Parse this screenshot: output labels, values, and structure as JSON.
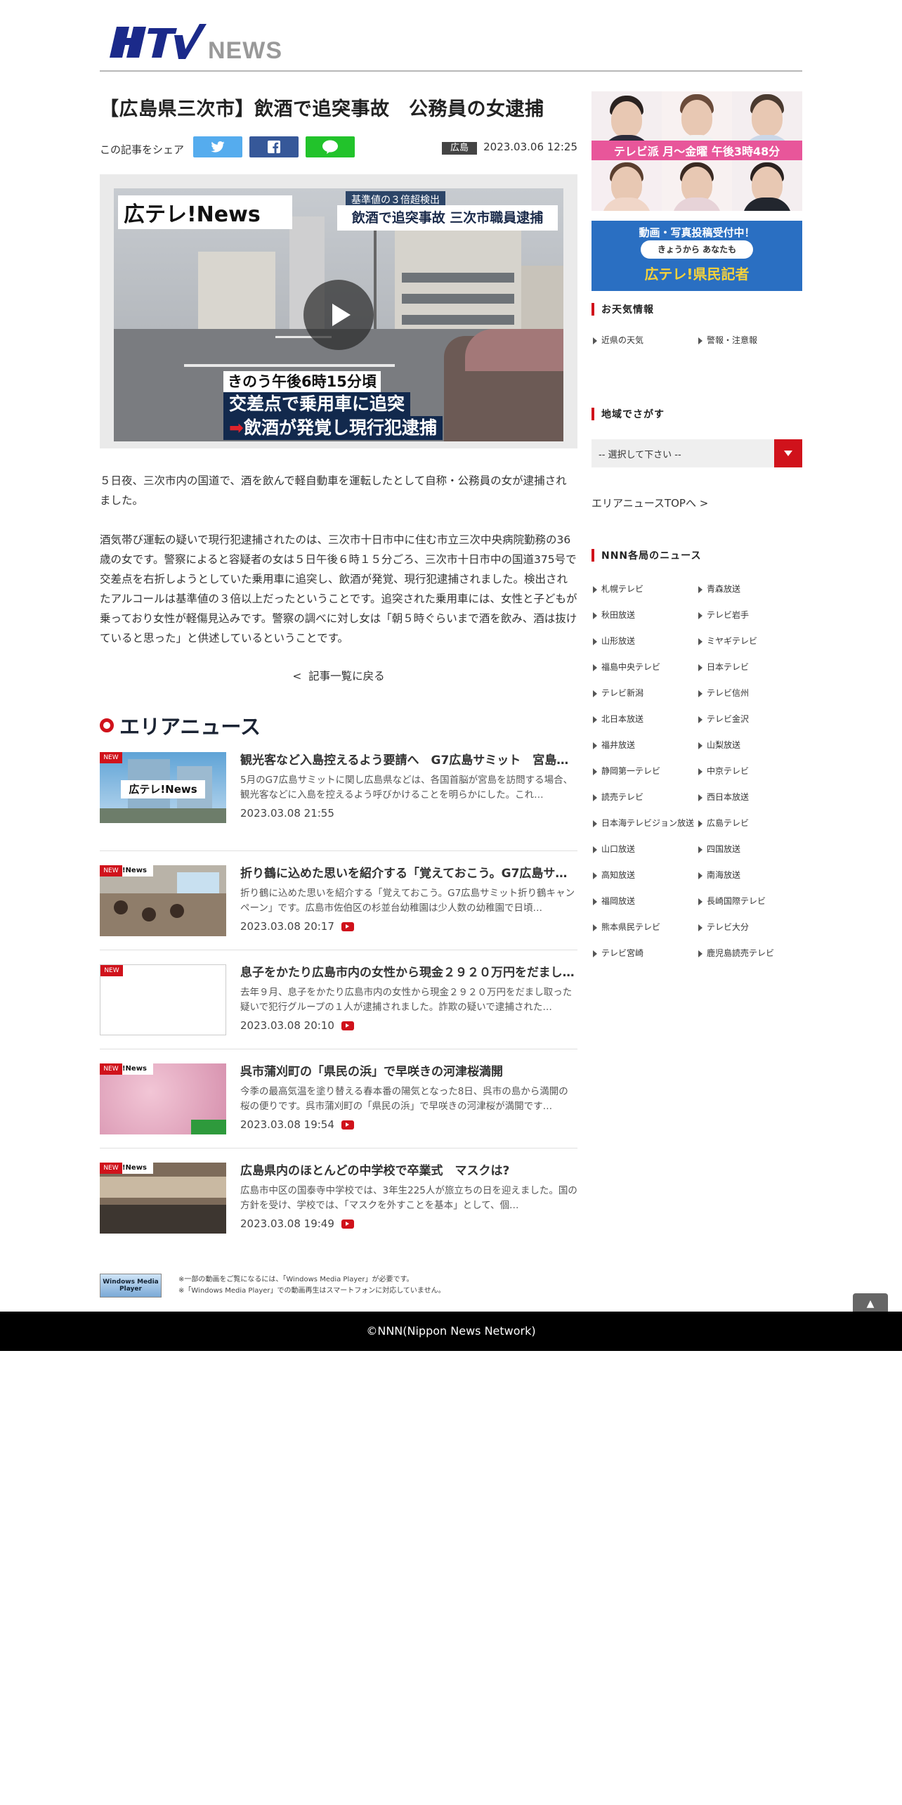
{
  "header": {
    "logo_text": "HTV",
    "logo_sub": "NEWS"
  },
  "article": {
    "title": "【広島県三次市】飲酒で追突事故　公務員の女逮捕",
    "share_label": "この記事をシェア",
    "share_line": "LINE",
    "area_tag": "広島",
    "published": "2023.03.06 12:25",
    "video": {
      "logo": "広テレ!News",
      "tag": "基準値の３倍超検出",
      "headline": "飲酒で追突事故 三次市職員逮捕",
      "caption1": "きのう午後6時15分頃",
      "caption2": "交差点で乗用車に追突",
      "caption3": "飲酒が発覚し現行犯逮捕",
      "arrow": "➡"
    },
    "paragraphs": [
      "５日夜、三次市内の国道で、酒を飲んで軽自動車を運転したとして自称・公務員の女が逮捕されました。",
      "酒気帯び運転の疑いで現行犯逮捕されたのは、三次市十日市中に住む市立三次中央病院勤務の36歳の女です。警察によると容疑者の女は５日午後６時１５分ごろ、三次市十日市中の国道375号で交差点を右折しようとしていた乗用車に追突し、飲酒が発覚、現行犯逮捕されました。検出されたアルコールは基準値の３倍以上だったということです。追突された乗用車には、女性と子どもが乗っており女性が軽傷見込みです。警察の調べに対し女は「朝５時ぐらいまで酒を飲み、酒は抜けていると思った」と供述しているということです。"
    ],
    "back_link": "記事一覧に戻る"
  },
  "area_news": {
    "heading": "エリアニュース",
    "new_badge": "NEW",
    "items": [
      {
        "title": "観光客など入島控えるよう要請へ　G7広島サミット　宮島…",
        "desc": "5月のG7広島サミットに関し広島県などは、各国首脳が宮島を訪問する場合、観光客などに入島を控えるよう呼びかけることを明らかにした。これ…",
        "date": "2023.03.08 21:55",
        "thumb_text": "広テレ!News"
      },
      {
        "title": "折り鶴に込めた思いを紹介する「覚えておこう。G7広島サミ…",
        "desc": "折り鶴に込めた思いを紹介する「覚えておこう。G7広島サミット折り鶴キャンペーン」です。広島市佐伯区の杉並台幼稚園は少人数の幼稚園で日頃…",
        "date": "2023.03.08 20:17",
        "thumb_text": "!News"
      },
      {
        "title": "息子をかたり広島市内の女性から現金２９２０万円をだまし…",
        "desc": "去年９月、息子をかたり広島市内の女性から現金２９２０万円をだまし取った疑いで犯行グループの１人が逮捕されました。詐欺の疑いで逮捕された…",
        "date": "2023.03.08 20:10",
        "thumb_text": ""
      },
      {
        "title": "呉市蒲刈町の「県民の浜」で早咲きの河津桜満開",
        "desc": "今季の最高気温を塗り替える春本番の陽気となった8日、呉市の島から満開の桜の便りです。呉市蒲刈町の「県民の浜」で早咲きの河津桜が満開です…",
        "date": "2023.03.08 19:54",
        "thumb_text": "!News"
      },
      {
        "title": "広島県内のほとんどの中学校で卒業式　マスクは?",
        "desc": "広島市中区の国泰寺中学校では、3年生225人が旅立ちの日を迎えました。国の方針を受け、学校では、「マスクを外すことを基本」として、個…",
        "date": "2023.03.08 19:49",
        "thumb_text": "!News"
      }
    ]
  },
  "wmp": {
    "badge": "Windows Media Player",
    "note1": "※一部の動画をご覧になるには、「Windows Media Player」が必要です。",
    "note2": "※「Windows Media Player」での動画再生はスマートフォンに対応していません。"
  },
  "sidebar": {
    "promo_band": "テレビ派 月～金曜 午後3時48分",
    "recruit_top": "動画・写真投稿受付中！",
    "recruit_mid": "きょうから あなたも",
    "recruit_bot": "広テレ!県民記者",
    "weather_heading": "お天気情報",
    "weather_links": [
      "近県の天気",
      "警報・注意報"
    ],
    "region_heading": "地域でさがす",
    "region_select": "-- 選択して下さい --",
    "area_top_link": "エリアニュースTOPへ",
    "nnn_heading": "NNN各局のニュース",
    "nnn_links": [
      "札幌テレビ",
      "青森放送",
      "秋田放送",
      "テレビ岩手",
      "山形放送",
      "ミヤギテレビ",
      "福島中央テレビ",
      "日本テレビ",
      "テレビ新潟",
      "テレビ信州",
      "北日本放送",
      "テレビ金沢",
      "福井放送",
      "山梨放送",
      "静岡第一テレビ",
      "中京テレビ",
      "読売テレビ",
      "西日本放送",
      "日本海テレビジョン放送",
      "広島テレビ",
      "山口放送",
      "四国放送",
      "高知放送",
      "南海放送",
      "福岡放送",
      "長崎国際テレビ",
      "熊本県民テレビ",
      "テレビ大分",
      "テレビ宮崎",
      "鹿児島読売テレビ"
    ]
  },
  "footer": {
    "copyright": "©NNN(Nippon News Network)"
  },
  "colors": {
    "accent": "#d0121b",
    "twitter": "#55acee",
    "facebook": "#365899",
    "line": "#22c32b",
    "footer_bg": "#000000"
  }
}
